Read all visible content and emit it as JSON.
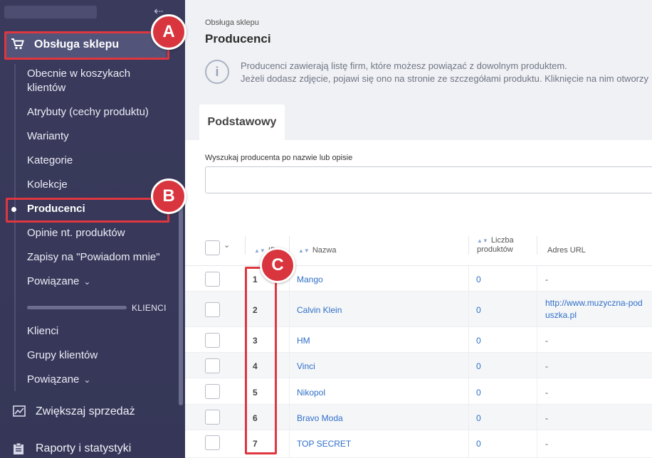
{
  "sidebar": {
    "collapse_icon": "collapse-left-icon",
    "section": {
      "icon": "cart-icon",
      "label": "Obsługa sklepu"
    },
    "items": [
      {
        "label": "Obecnie w koszykach klientów",
        "active": false
      },
      {
        "label": "Atrybuty (cechy produktu)",
        "active": false
      },
      {
        "label": "Warianty",
        "active": false
      },
      {
        "label": "Kategorie",
        "active": false
      },
      {
        "label": "Kolekcje",
        "active": false
      },
      {
        "label": "Producenci",
        "active": true
      },
      {
        "label": "Opinie nt. produktów",
        "active": false
      },
      {
        "label": "Zapisy na \"Powiadom mnie\"",
        "active": false
      },
      {
        "label": "Powiązane",
        "active": false,
        "has_chevron": true
      }
    ],
    "separator_label": "KLIENCI",
    "client_items": [
      {
        "label": "Klienci"
      },
      {
        "label": "Grupy klientów"
      },
      {
        "label": "Powiązane",
        "has_chevron": true
      }
    ],
    "main_items": [
      {
        "icon": "chart-line-icon",
        "label": "Zwiększaj sprzedaż"
      },
      {
        "icon": "clipboard-icon",
        "label": "Raporty i statystyki"
      }
    ]
  },
  "header": {
    "breadcrumb": "Obsługa sklepu",
    "title": "Producenci"
  },
  "info": {
    "icon": "info-icon",
    "line1": "Producenci zawierają listę firm, które możesz powiązać z dowolnym produktem.",
    "line2": "Jeżeli dodasz zdjęcie, pojawi się ono na stronie ze szczegółami produktu. Kliknięcie na nim otworzy"
  },
  "tabs": [
    {
      "label": "Podstawowy",
      "active": true
    }
  ],
  "search": {
    "label": "Wyszukaj producenta po nazwie lub opisie",
    "value": "",
    "placeholder": ""
  },
  "table": {
    "columns": {
      "id": "ID",
      "name": "Nazwa",
      "count": "Liczba produktów",
      "url": "Adres URL"
    },
    "rows": [
      {
        "id": "1",
        "name": "Mango",
        "count": "0",
        "url": "-"
      },
      {
        "id": "2",
        "name": "Calvin Klein",
        "count": "0",
        "url": "http://www.muzyczna-poduszka.pl"
      },
      {
        "id": "3",
        "name": "HM",
        "count": "0",
        "url": "-"
      },
      {
        "id": "4",
        "name": "Vinci",
        "count": "0",
        "url": "-"
      },
      {
        "id": "5",
        "name": "Nikopol",
        "count": "0",
        "url": "-"
      },
      {
        "id": "6",
        "name": "Bravo Moda",
        "count": "0",
        "url": "-"
      },
      {
        "id": "7",
        "name": "TOP SECRET",
        "count": "0",
        "url": "-"
      }
    ]
  },
  "callouts": [
    {
      "label": "A"
    },
    {
      "label": "B"
    },
    {
      "label": "C"
    }
  ],
  "colors": {
    "sidebar_bg": "#3a3b5c",
    "accent": "#2f6fc8",
    "callout": "#e0363f"
  }
}
